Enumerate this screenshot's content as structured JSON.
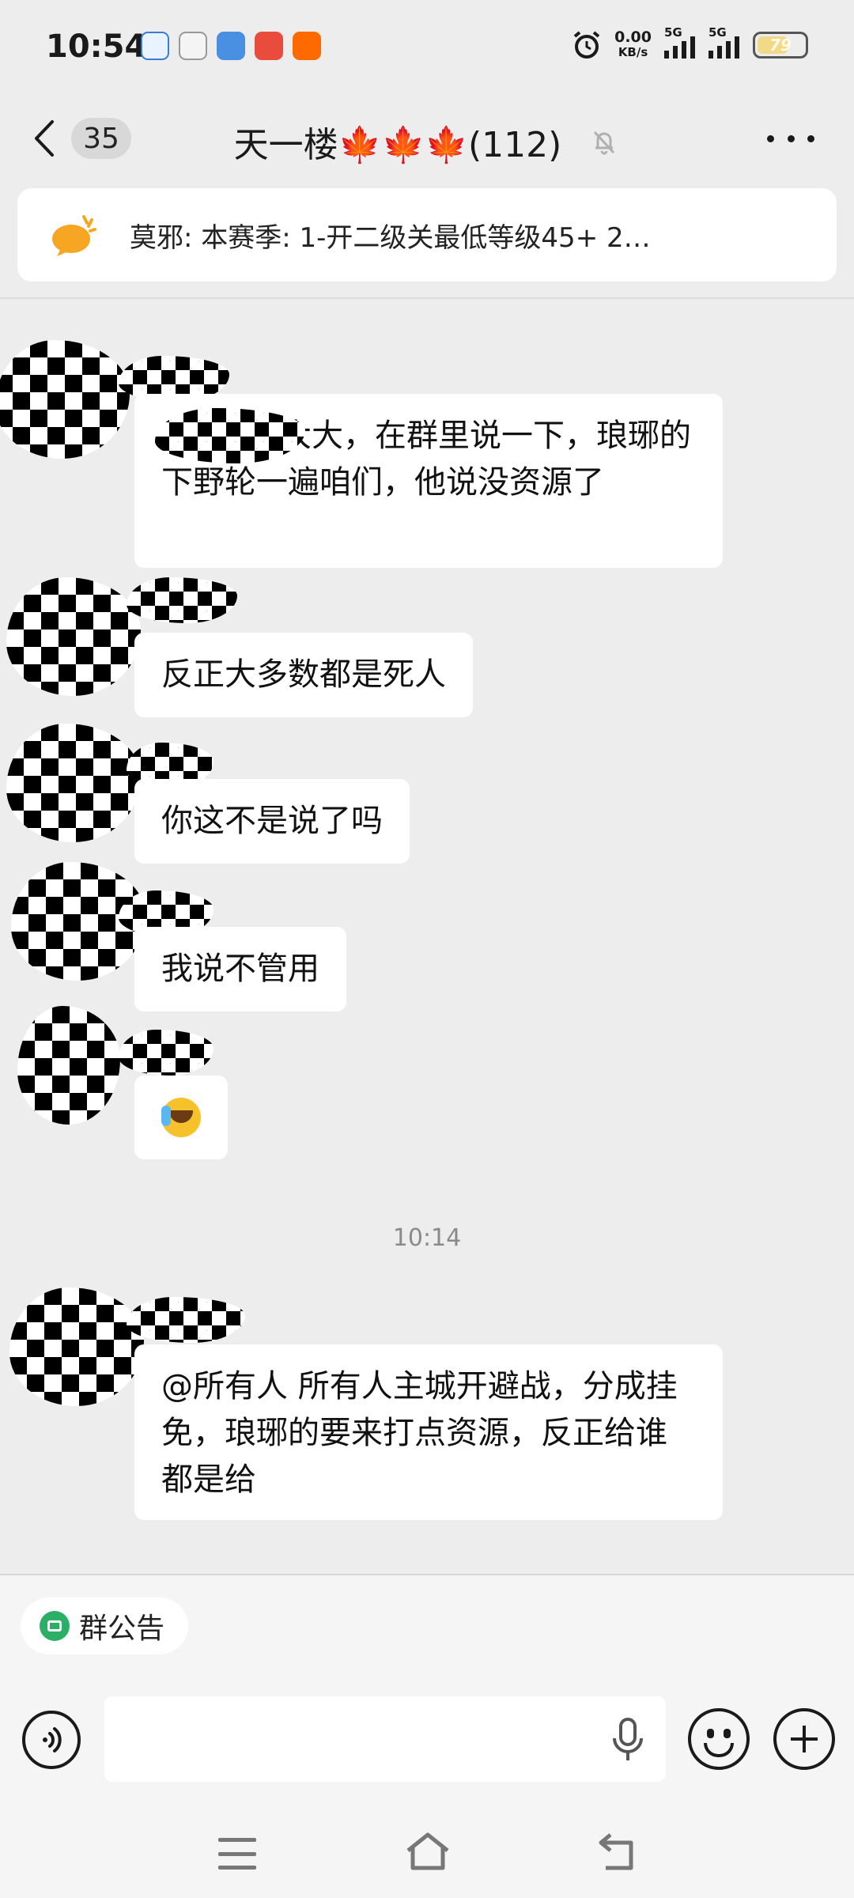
{
  "status_bar": {
    "time": "10:54",
    "net_speed_value": "0.00",
    "net_speed_unit": "KB/s",
    "signal1_label": "5G",
    "signal2_label": "5G",
    "battery": "79"
  },
  "header": {
    "unread_count": "35",
    "title": "天一楼🍁🍁🍁(112)"
  },
  "announcement": {
    "text": "莫邪: 本赛季: 1-开二级关最低等级45+ 2…"
  },
  "messages": [
    {
      "text": "大大，在群里说一下，琅琊的下野轮一遍咱们，他说没资源了"
    },
    {
      "text": "反正大多数都是死人"
    },
    {
      "text": "你这不是说了吗"
    },
    {
      "text": "我说不管用"
    },
    {
      "text": ""
    },
    {
      "text": "@所有人  所有人主城开避战，分成挂免，琅琊的要来打点资源，反正给谁都是给"
    }
  ],
  "timestamp": "10:14",
  "bottom": {
    "group_notice_label": "群公告",
    "input_placeholder": ""
  },
  "colors": {
    "background": "#ededed",
    "bubble": "#ffffff",
    "accent_green": "#2bae66"
  }
}
